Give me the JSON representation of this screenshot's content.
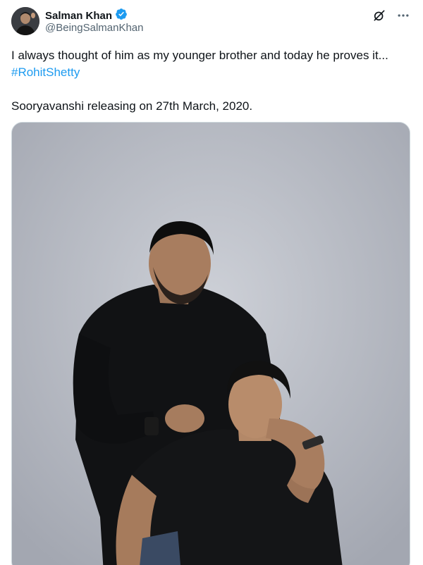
{
  "author": {
    "display_name": "Salman Khan",
    "handle": "@BeingSalmanKhan",
    "verified": true
  },
  "icons": {
    "verified": "verified-badge-icon",
    "grok": "grok-icon",
    "more": "more-options-icon"
  },
  "tweet": {
    "text_line1": "I always thought of him as my younger brother and today he proves it...",
    "hashtag": "#RohitShetty",
    "text_line3": "Sooryavanshi releasing on 27th March, 2020."
  },
  "colors": {
    "link": "#1d9bf0",
    "text": "#0f1419",
    "secondary": "#536471",
    "verified": "#1d9bf0"
  }
}
